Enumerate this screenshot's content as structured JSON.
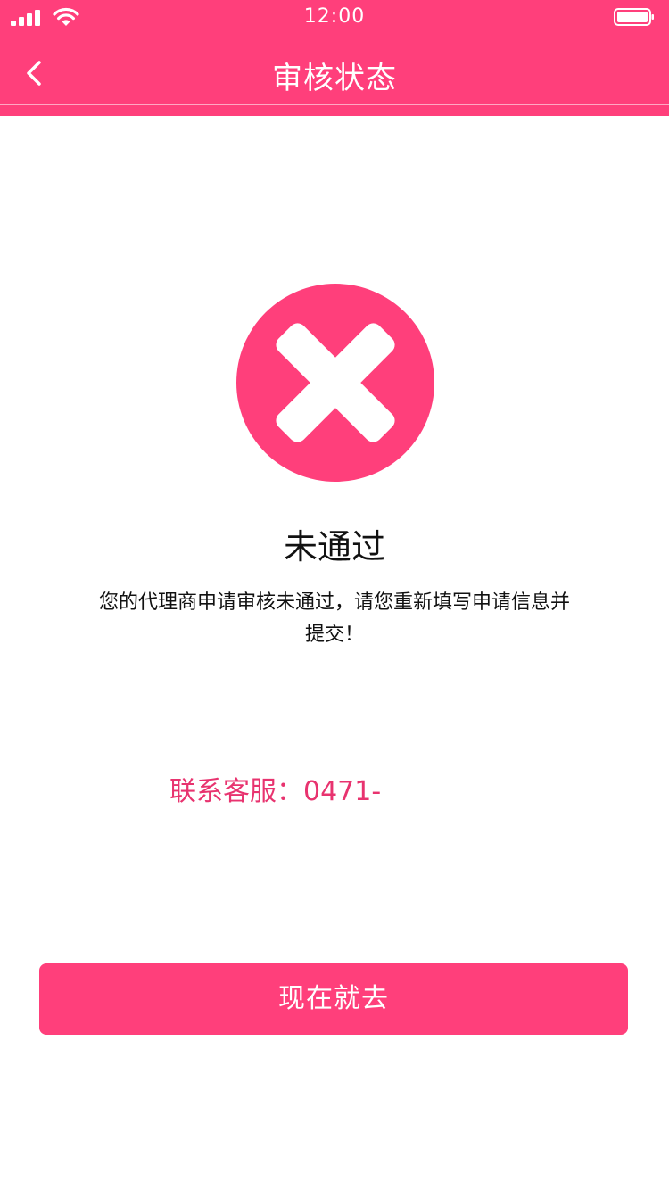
{
  "status_bar": {
    "time": "12:00",
    "signal_icon": "cellular-signal-icon",
    "wifi_icon": "wifi-icon",
    "battery_icon": "battery-icon"
  },
  "nav": {
    "back_icon": "chevron-left-icon",
    "title": "审核状态"
  },
  "result": {
    "icon": "close-circle-icon",
    "title": "未通过",
    "description": "您的代理商申请审核未通过，请您重新填写申请信息并提交！"
  },
  "contact": {
    "label": "联系客服：",
    "phone": "0471-"
  },
  "action": {
    "button_label": "现在就去"
  },
  "colors": {
    "primary": "#ff3f7b",
    "accent_text": "#e8336f"
  }
}
